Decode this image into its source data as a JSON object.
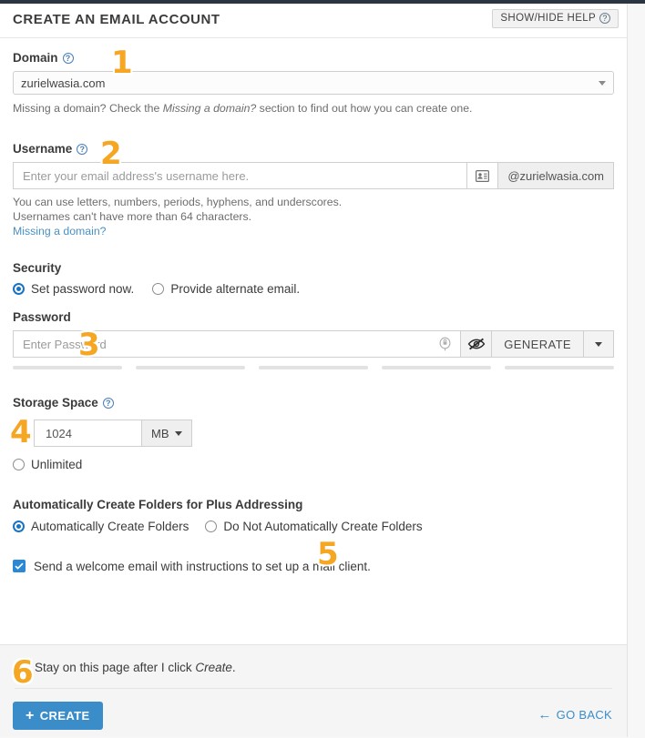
{
  "header": {
    "title": "CREATE AN EMAIL ACCOUNT",
    "help_toggle_label": "SHOW/HIDE HELP"
  },
  "domain": {
    "label": "Domain",
    "selected": "zurielwasia.com",
    "hint_before": "Missing a domain? Check the ",
    "hint_italic": "Missing a domain?",
    "hint_after": " section to find out how you can create one."
  },
  "username": {
    "label": "Username",
    "placeholder": "Enter your email address's username here.",
    "domain_addon": "@zurielwasia.com",
    "hint_line1": "You can use letters, numbers, periods, hyphens, and underscores.",
    "hint_line2": "Usernames can't have more than 64 characters.",
    "link": "Missing a domain?"
  },
  "security": {
    "label": "Security",
    "option_set_password": "Set password now.",
    "option_alternate_email": "Provide alternate email.",
    "selected": "set_password"
  },
  "password": {
    "label": "Password",
    "placeholder": "Enter Password",
    "generate_label": "GENERATE",
    "strength_segments": [
      0,
      0,
      0,
      0,
      0
    ]
  },
  "storage": {
    "label": "Storage Space",
    "value": "1024",
    "unit": "MB",
    "unlimited_label": "Unlimited",
    "selected": "fixed"
  },
  "plus_addressing": {
    "label": "Automatically Create Folders for Plus Addressing",
    "option_auto": "Automatically Create Folders",
    "option_manual": "Do Not Automatically Create Folders",
    "selected": "auto"
  },
  "welcome_email": {
    "label": "Send a welcome email with instructions to set up a mail client.",
    "checked": true
  },
  "footer": {
    "stay_label_before": "Stay on this page after I click ",
    "stay_label_italic": "Create",
    "stay_label_after": ".",
    "create_button": "CREATE",
    "go_back": "GO BACK"
  },
  "callouts": [
    {
      "n": "1"
    },
    {
      "n": "2"
    },
    {
      "n": "3"
    },
    {
      "n": "4"
    },
    {
      "n": "5"
    },
    {
      "n": "6"
    }
  ],
  "colors": {
    "accent_blue": "#3a8dc8",
    "callout_orange": "#F5A623",
    "radio_blue": "#1b73c4",
    "topbar_navy": "#2b3542"
  }
}
